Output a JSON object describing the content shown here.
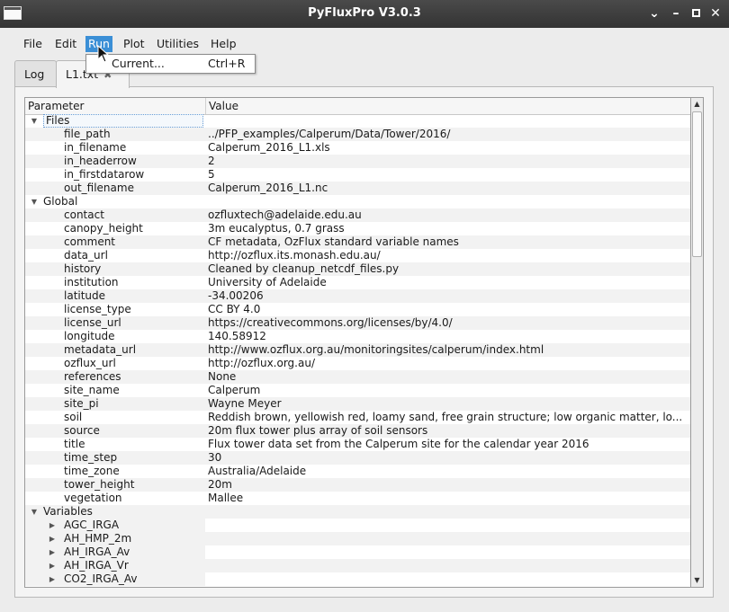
{
  "window": {
    "title": "PyFluxPro V3.0.3"
  },
  "menu": [
    "File",
    "Edit",
    "Run",
    "Plot",
    "Utilities",
    "Help"
  ],
  "run_menu": {
    "items": [
      {
        "label": "Current...",
        "shortcut": "Ctrl+R"
      }
    ]
  },
  "tabs": [
    {
      "label": "Log"
    },
    {
      "label": "L1.txt"
    }
  ],
  "tree": {
    "headers": [
      "Parameter",
      "Value"
    ],
    "rows": [
      {
        "level": 0,
        "expand": "open",
        "param": "Files",
        "value": ""
      },
      {
        "level": 1,
        "param": "file_path",
        "value": "../PFP_examples/Calperum/Data/Tower/2016/"
      },
      {
        "level": 1,
        "param": "in_filename",
        "value": "Calperum_2016_L1.xls"
      },
      {
        "level": 1,
        "param": "in_headerrow",
        "value": "2"
      },
      {
        "level": 1,
        "param": "in_firstdatarow",
        "value": "5"
      },
      {
        "level": 1,
        "param": "out_filename",
        "value": "Calperum_2016_L1.nc"
      },
      {
        "level": 0,
        "expand": "open",
        "param": "Global",
        "value": ""
      },
      {
        "level": 1,
        "param": "contact",
        "value": "ozfluxtech@adelaide.edu.au"
      },
      {
        "level": 1,
        "param": "canopy_height",
        "value": "3m eucalyptus, 0.7 grass"
      },
      {
        "level": 1,
        "param": "comment",
        "value": "CF metadata, OzFlux standard variable names"
      },
      {
        "level": 1,
        "param": "data_url",
        "value": "http://ozflux.its.monash.edu.au/"
      },
      {
        "level": 1,
        "param": "history",
        "value": "Cleaned by cleanup_netcdf_files.py"
      },
      {
        "level": 1,
        "param": "institution",
        "value": "University of Adelaide"
      },
      {
        "level": 1,
        "param": "latitude",
        "value": "-34.00206"
      },
      {
        "level": 1,
        "param": "license_type",
        "value": "CC BY 4.0"
      },
      {
        "level": 1,
        "param": "license_url",
        "value": "https://creativecommons.org/licenses/by/4.0/"
      },
      {
        "level": 1,
        "param": "longitude",
        "value": "140.58912"
      },
      {
        "level": 1,
        "param": "metadata_url",
        "value": "http://www.ozflux.org.au/monitoringsites/calperum/index.html"
      },
      {
        "level": 1,
        "param": "ozflux_url",
        "value": "http://ozflux.org.au/"
      },
      {
        "level": 1,
        "param": "references",
        "value": "None"
      },
      {
        "level": 1,
        "param": "site_name",
        "value": "Calperum"
      },
      {
        "level": 1,
        "param": "site_pi",
        "value": "Wayne Meyer"
      },
      {
        "level": 1,
        "param": "soil",
        "value": "Reddish brown, yellowish red, loamy sand, free grain structure; low organic matter, lo..."
      },
      {
        "level": 1,
        "param": "source",
        "value": "20m flux tower plus array of soil sensors"
      },
      {
        "level": 1,
        "param": "title",
        "value": "Flux tower data set from the Calperum site for the calendar year 2016"
      },
      {
        "level": 1,
        "param": "time_step",
        "value": "30"
      },
      {
        "level": 1,
        "param": "time_zone",
        "value": "Australia/Adelaide"
      },
      {
        "level": 1,
        "param": "tower_height",
        "value": "20m"
      },
      {
        "level": 1,
        "param": "vegetation",
        "value": "Mallee"
      },
      {
        "level": 0,
        "expand": "open",
        "param": "Variables",
        "value": ""
      },
      {
        "level": 1,
        "expand": "closed",
        "param": "AGC_IRGA",
        "value": ""
      },
      {
        "level": 1,
        "expand": "closed",
        "param": "AH_HMP_2m",
        "value": ""
      },
      {
        "level": 1,
        "expand": "closed",
        "param": "AH_IRGA_Av",
        "value": ""
      },
      {
        "level": 1,
        "expand": "closed",
        "param": "AH_IRGA_Vr",
        "value": ""
      },
      {
        "level": 1,
        "expand": "closed",
        "param": "CO2_IRGA_Av",
        "value": ""
      }
    ]
  }
}
